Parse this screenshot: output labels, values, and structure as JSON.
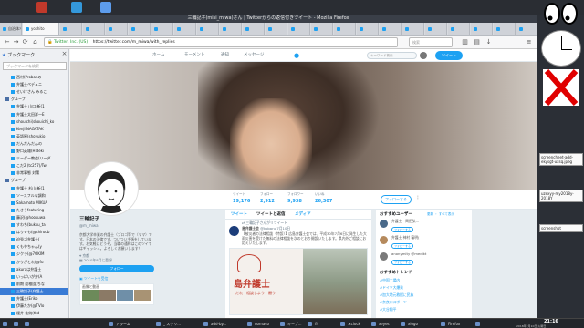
{
  "window_title": "三輪記子(misi_miwa)さん | Twitterからの返信付きツイート - Mozilla Firefox",
  "tabs": [
    "自治体:CPU",
    "yoshito",
    "",
    "",
    "",
    "",
    "",
    "",
    "",
    "",
    "",
    "",
    "",
    "",
    "",
    "",
    "",
    "",
    "",
    "",
    "",
    "",
    ""
  ],
  "url": "https://twitter.com/m_miwa/with_replies",
  "url_site": "Twitter, Inc. (US)",
  "ff_search_placeholder": "検索",
  "sidebar": {
    "title": "ブックマーク",
    "search_placeholder": "ブックマークを検索",
    "items": [
      {
        "label": "西村(Probanの",
        "type": "item"
      },
      {
        "label": "弁護士ペデュニ",
        "type": "item"
      },
      {
        "label": "せいけさん みるこ",
        "type": "item"
      },
      {
        "label": "グループ",
        "type": "folder"
      },
      {
        "label": "弁護士 山口 新(1",
        "type": "item"
      },
      {
        "label": "弁護士太田洋一E",
        "type": "item"
      },
      {
        "label": "shouichi(shouichi_ko",
        "type": "item"
      },
      {
        "label": "Kenji NAGATAK",
        "type": "item"
      },
      {
        "label": "英語屋(shoyukio",
        "type": "item"
      },
      {
        "label": "だんだんだんの",
        "type": "item"
      },
      {
        "label": "野口英雄(Hideki",
        "type": "item"
      },
      {
        "label": "リーダー教会(リーダ",
        "type": "item"
      },
      {
        "label": "こだ2 (tc257)/Tw",
        "type": "item"
      },
      {
        "label": "非常事態 対策",
        "type": "item"
      },
      {
        "label": "グループ",
        "type": "folder"
      },
      {
        "label": "弁護士 杉山 新(1",
        "type": "item"
      },
      {
        "label": "ソースフルな調和",
        "type": "item"
      },
      {
        "label": "Sakamoto MIKUA",
        "type": "item"
      },
      {
        "label": "たきうfeaturing",
        "type": "item"
      },
      {
        "label": "藤沢(@hookuwa",
        "type": "item"
      },
      {
        "label": "すわち(bukku_ta",
        "type": "item"
      },
      {
        "label": "はりぐも(@shiroub",
        "type": "item"
      },
      {
        "label": "迫兎ゴ弁護士(",
        "type": "item"
      },
      {
        "label": "くもやちゃん(y",
        "type": "item"
      },
      {
        "label": "ジクラ(@7OKIM",
        "type": "item"
      },
      {
        "label": "かりがとれ(@fu",
        "type": "item"
      },
      {
        "label": "akuraは弁護士",
        "type": "item"
      },
      {
        "label": "いっぱいが弁(A",
        "type": "item"
      },
      {
        "label": "前期 幼稚園(ちな",
        "type": "item"
      },
      {
        "label": "三輪記子(弁護士",
        "type": "selected"
      },
      {
        "label": "弁護士(Eriko",
        "type": "item"
      },
      {
        "label": "伊藤たか(@TVlo",
        "type": "item"
      },
      {
        "label": "榎井 佳純(tkd",
        "type": "item"
      }
    ]
  },
  "twitter": {
    "nav": [
      "ホーム",
      "モーメント",
      "通知",
      "メッセージ"
    ],
    "search_placeholder": "キーワード検索",
    "tweet_button": "ツイート",
    "stats": [
      {
        "label": "ツイート",
        "value": "19,176"
      },
      {
        "label": "フォロー",
        "value": "2,912"
      },
      {
        "label": "フォロワー",
        "value": "9,938"
      },
      {
        "label": "いいね",
        "value": "26,307"
      }
    ],
    "follow_button": "フォローする",
    "profile": {
      "name": "三輪記子",
      "handle": "@m_miwa",
      "bio": "京都大学卒業の弁護士（ブロゴ等で（ママ）です。日本の法律です。ついつい主張をしています。お気軽にどうぞ。当職の通称はこのツイではギャッシュ。よろしくお願いします！",
      "location": "京都",
      "joined": "2010年8月に登録",
      "follow_button": "フォロー",
      "media_label": "ツイートを受信",
      "photos_label": "画像と動画"
    },
    "timeline_tabs": [
      "ツイート",
      "ツイートと返信",
      "メディア"
    ],
    "tweet": {
      "retweet_note": "三輪記子さんがリツイート",
      "author": "島弁護士会",
      "handle": "@kobaru",
      "time": "7月10日",
      "text": "【被災者の法律相談（特設）】広島弁護士会では、平成30年7月6日に発生した大雨災害を受けた無料の法律相談を次のとおり開設いたします。県内外ご相談にお応えいたします。",
      "image_title": "島弁護士",
      "image_caption": "だれ　相談しよう　願う"
    },
    "who_to_follow": {
      "title": "おすすめユーザー",
      "refresh": "更新 ・ すべて表示",
      "users": [
        {
          "name": "弁護士　岡田弘...",
          "button": "フォローする"
        },
        {
          "name": "弁護士 神村 審明(",
          "button": "フォローする"
        },
        {
          "name": "anonymity @medikt",
          "button": "フォローする"
        }
      ]
    },
    "trends": {
      "title": "おすすめトレンド",
      "items": [
        "#中国工場内",
        "#ドイツ大爆発",
        "#加大地元救援に民族",
        "#奈良川スポーツ",
        "#大谷翔平"
      ]
    }
  },
  "taskbar": {
    "items": [
      "",
      "",
      "",
      "アラーム",
      "_ スクリ...",
      "add-by...",
      "nomaco",
      "キーブ...",
      "fit",
      ".xclock",
      "xeyes",
      "xlogo",
      "Firefox",
      ""
    ],
    "clock": "21:16",
    "date": "2018年7月10日 火曜日"
  },
  "widgets": {
    "note1": "screencheet-add-ekysgt-uxsq.jpeg",
    "note2": "uzexyy-my2018y-2018Y",
    "note3": "screenshot"
  },
  "colors": {
    "twitter_blue": "#1da1f2",
    "selected": "#3a7bd5",
    "xlogo": "#e00000"
  }
}
